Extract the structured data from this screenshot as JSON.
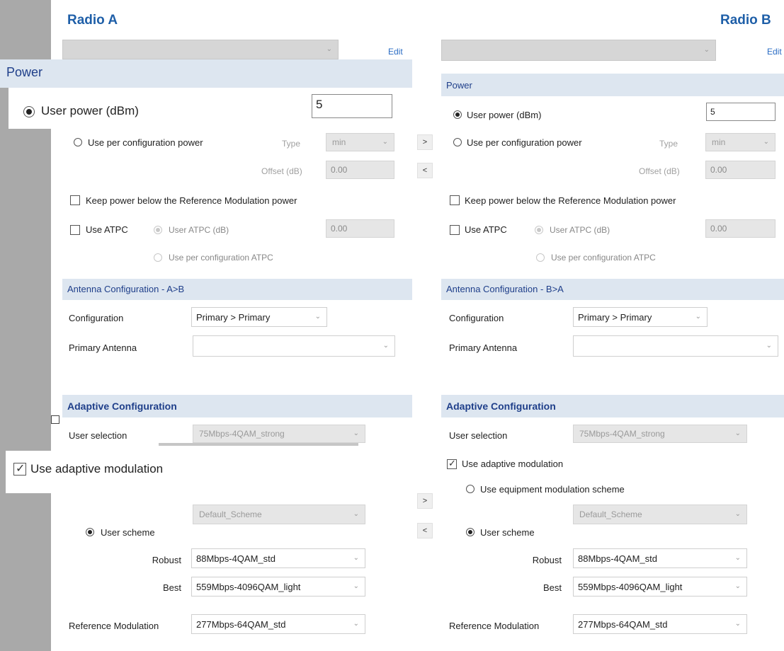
{
  "radio_a": {
    "title": "Radio A",
    "edit": "Edit",
    "power": {
      "header": "Power",
      "user_power_label": "User power (dBm)",
      "user_power_value": "5",
      "per_config_label": "Use per configuration power",
      "type_label": "Type",
      "type_value": "min",
      "offset_label": "Offset (dB)",
      "offset_value": "0.00",
      "keep_below_label": "Keep power below the Reference Modulation power",
      "use_atpc_label": "Use ATPC",
      "user_atpc_label": "User ATPC (dB)",
      "atpc_value": "0.00",
      "per_config_atpc_label": "Use per configuration ATPC"
    },
    "antenna": {
      "header": "Antenna Configuration - A>B",
      "configuration_label": "Configuration",
      "configuration_value": "Primary > Primary",
      "primary_antenna_label": "Primary Antenna"
    },
    "adaptive": {
      "header": "Adaptive Configuration",
      "user_selection_label": "User selection",
      "user_selection_value": "75Mbps-4QAM_strong",
      "use_adaptive_label": "Use adaptive modulation",
      "scheme_value": "Default_Scheme",
      "user_scheme_label": "User scheme",
      "robust_label": "Robust",
      "robust_value": "88Mbps-4QAM_std",
      "best_label": "Best",
      "best_value": "559Mbps-4096QAM_light",
      "ref_mod_label": "Reference Modulation",
      "ref_mod_value": "277Mbps-64QAM_std"
    }
  },
  "radio_b": {
    "title": "Radio B",
    "edit": "Edit",
    "power": {
      "header": "Power",
      "user_power_label": "User power (dBm)",
      "user_power_value": "5",
      "per_config_label": "Use per configuration power",
      "type_label": "Type",
      "type_value": "min",
      "offset_label": "Offset (dB)",
      "offset_value": "0.00",
      "keep_below_label": "Keep power below the Reference Modulation power",
      "use_atpc_label": "Use ATPC",
      "user_atpc_label": "User ATPC (dB)",
      "atpc_value": "0.00",
      "per_config_atpc_label": "Use per configuration ATPC"
    },
    "antenna": {
      "header": "Antenna Configuration - B>A",
      "configuration_label": "Configuration",
      "configuration_value": "Primary > Primary",
      "primary_antenna_label": "Primary Antenna"
    },
    "adaptive": {
      "header": "Adaptive Configuration",
      "user_selection_label": "User selection",
      "user_selection_value": "75Mbps-4QAM_strong",
      "use_adaptive_label": "Use adaptive modulation",
      "use_equipment_label": "Use equipment modulation scheme",
      "scheme_value": "Default_Scheme",
      "user_scheme_label": "User scheme",
      "robust_label": "Robust",
      "robust_value": "88Mbps-4QAM_std",
      "best_label": "Best",
      "best_value": "559Mbps-4096QAM_light",
      "ref_mod_label": "Reference Modulation",
      "ref_mod_value": "277Mbps-64QAM_std"
    }
  },
  "copy_buttons": {
    "to_right": ">",
    "to_left": "<"
  },
  "icons": {
    "chevron": "chevron-down-icon",
    "check": "check-icon"
  },
  "colors": {
    "title_blue": "#1f5fa8",
    "band_bg": "#dde6f0",
    "band_text": "#1f3f8a",
    "side_gray": "#a9a9a9"
  }
}
